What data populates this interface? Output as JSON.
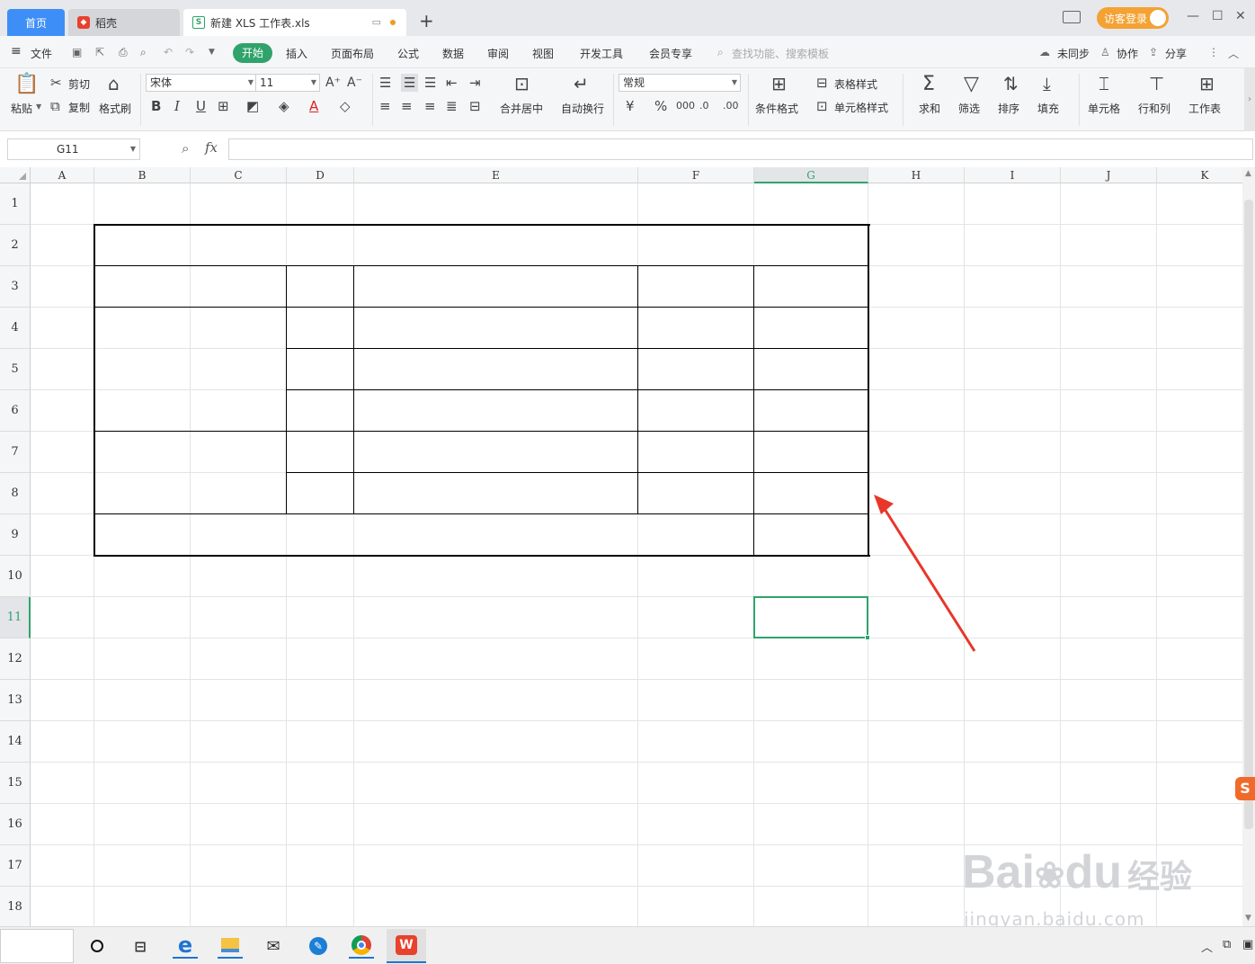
{
  "titlebar": {
    "tab_home": "首页",
    "tab_daoke": "稻壳",
    "tab_file": "新建 XLS 工作表.xls",
    "new_tab": "+",
    "login": "访客登录"
  },
  "menu": {
    "file": "文件",
    "start": "开始",
    "items": [
      "插入",
      "页面布局",
      "公式",
      "数据",
      "审阅",
      "视图",
      "开发工具",
      "会员专享"
    ],
    "search_placeholder": "查找功能、搜索模板",
    "sync": "未同步",
    "collab": "协作",
    "share": "分享"
  },
  "ribbon": {
    "paste": "粘贴",
    "cut": "剪切",
    "copy": "复制",
    "format_painter": "格式刷",
    "font_name": "宋体",
    "font_size": "11",
    "merge_center": "合并居中",
    "wrap_text": "自动换行",
    "number_format": "常规",
    "conditional_format": "条件格式",
    "table_style": "表格样式",
    "cell_style": "单元格样式",
    "sum": "求和",
    "filter": "筛选",
    "sort": "排序",
    "fill": "填充",
    "cell": "单元格",
    "row_col": "行和列",
    "worksheet": "工作表"
  },
  "formula_bar": {
    "name_box": "G11",
    "fx": "fx",
    "formula": ""
  },
  "columns": [
    "A",
    "B",
    "C",
    "D",
    "E",
    "F",
    "G",
    "H",
    "I",
    "J",
    "K"
  ],
  "rows": [
    "1",
    "2",
    "3",
    "4",
    "5",
    "6",
    "7",
    "8",
    "9",
    "10",
    "11",
    "12",
    "13",
    "14",
    "15",
    "16",
    "17",
    "18"
  ],
  "selected_cell": "G11",
  "colors": {
    "accent_green": "#2fa36b",
    "home_tab_blue": "#3e8ef7",
    "login_orange": "#f4a233",
    "arrow_red": "#e8362a"
  },
  "watermark": {
    "brand": "Bai",
    "brand2": "du",
    "cn": "经验",
    "url": "jingyan.baidu.com"
  }
}
